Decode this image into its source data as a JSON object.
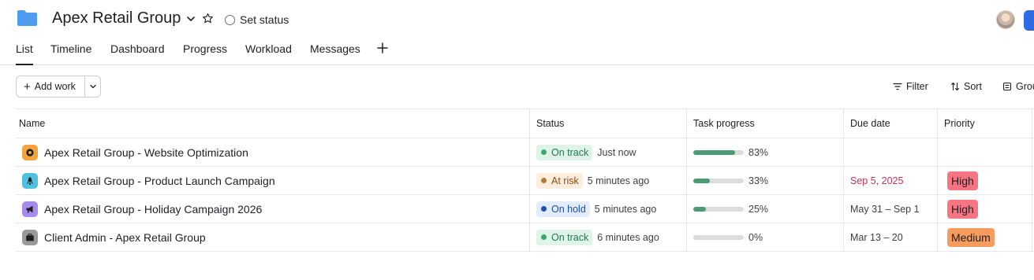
{
  "header": {
    "title": "Apex Retail Group",
    "set_status": "Set status"
  },
  "tabs": [
    {
      "label": "List",
      "active": true
    },
    {
      "label": "Timeline"
    },
    {
      "label": "Dashboard"
    },
    {
      "label": "Progress"
    },
    {
      "label": "Workload"
    },
    {
      "label": "Messages"
    }
  ],
  "toolbar": {
    "add_work": "Add work",
    "filter": "Filter",
    "sort": "Sort",
    "group": "Grou"
  },
  "table": {
    "columns": [
      "Name",
      "Status",
      "Task progress",
      "Due date",
      "Priority"
    ],
    "rows": [
      {
        "name": "Apex Retail Group - Website Optimization",
        "icon": "gear-icon",
        "icon_color": "#f1a33c",
        "status": "On track",
        "status_time": "Just now",
        "progress": 83,
        "progress_label": "83%",
        "due": "",
        "priority": ""
      },
      {
        "name": "Apex Retail Group - Product Launch Campaign",
        "icon": "rocket-icon",
        "icon_color": "#4ec1e0",
        "status": "At risk",
        "status_time": "5 minutes ago",
        "progress": 33,
        "progress_label": "33%",
        "due": "Sep 5, 2025",
        "due_overdue": true,
        "priority": "High"
      },
      {
        "name": "Apex Retail Group - Holiday Campaign 2026",
        "icon": "megaphone-icon",
        "icon_color": "#a78bea",
        "status": "On hold",
        "status_time": "5 minutes ago",
        "progress": 25,
        "progress_label": "25%",
        "due": "May 31 – Sep 1",
        "priority": "High"
      },
      {
        "name": "Client Admin - Apex Retail Group",
        "icon": "briefcase-icon",
        "icon_color": "#9a9a9a",
        "status": "On track",
        "status_time": "6 minutes ago",
        "progress": 0,
        "progress_label": "0%",
        "due": "Mar 13 – 20",
        "priority": "Medium"
      }
    ]
  },
  "colors": {
    "on_track_bg": "#dff3e9",
    "on_track_fg": "#1f7a52",
    "on_track_dot": "#3ea574",
    "at_risk_bg": "#fbeedf",
    "at_risk_fg": "#8a4e13",
    "at_risk_dot": "#b7793a",
    "on_hold_bg": "#e3ecfb",
    "on_hold_fg": "#1a4fae",
    "on_hold_dot": "#1f4fb8",
    "high": "#f77583",
    "medium": "#f89b5e",
    "progress_fill": "#4b9b77",
    "progress_track": "#dcdcdc",
    "folder": "#4d9cf0",
    "accent": "#2e6ce6"
  }
}
